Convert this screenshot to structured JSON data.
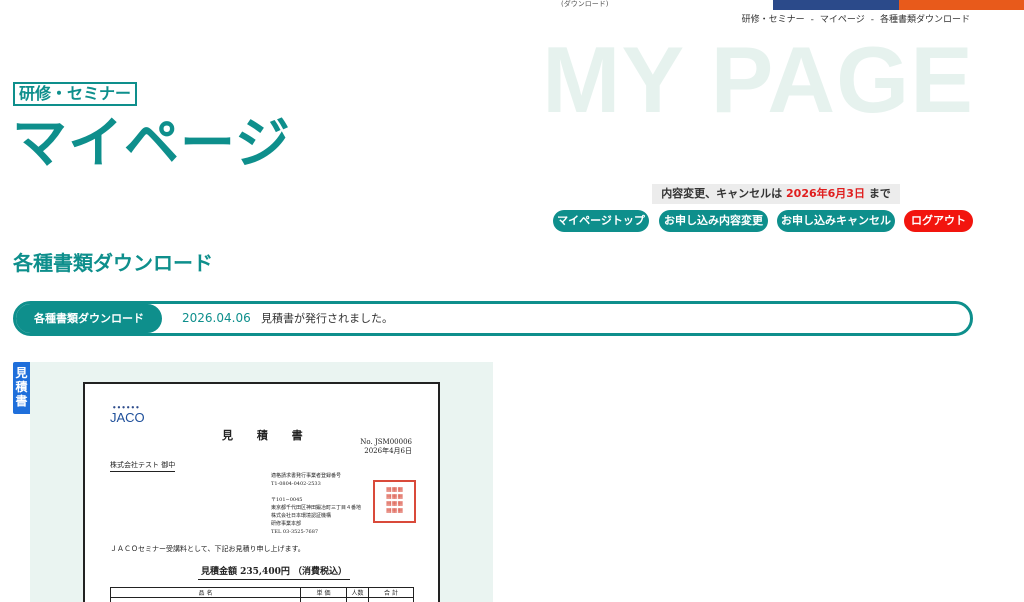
{
  "top": {
    "download_note": "(ダウンロード)",
    "colors": {
      "navy": "#2b4a8a",
      "orange": "#e85a1b"
    }
  },
  "breadcrumb": [
    "研修・セミナー",
    "マイページ",
    "各種書類ダウンロード"
  ],
  "breadcrumb_sep": "-",
  "hero": {
    "bg_title": "MY PAGE",
    "category": "研修・セミナー",
    "title": "マイページ"
  },
  "deadline": {
    "prefix": "内容変更、キャンセルは",
    "date": "2026年6月3日",
    "suffix": "まで"
  },
  "nav_buttons": {
    "mypage_top": "マイページトップ",
    "change": "お申し込み内容変更",
    "cancel": "お申し込みキャンセル",
    "logout": "ログアウト"
  },
  "section": {
    "heading": "各種書類ダウンロード"
  },
  "notice": {
    "tag": "各種書類ダウンロード",
    "date": "2026.04.06",
    "message": "見積書が発行されました。"
  },
  "document": {
    "tab_label": "見積書",
    "logo": "JACO",
    "title": "見 積 書",
    "number": "No. JSM00006",
    "date": "2026年4月6日",
    "addressee": "株式会社テスト 御中",
    "issuer_lines": [
      "適格請求書発行事業者登録番号",
      "T1-0804-0402-2533",
      "",
      "〒101−0045",
      "東京都千代田区神田鍛冶町三丁目４番地",
      "株式会社日本環境認証機構",
      "研修事業本部",
      "TEL 03-3525-7687"
    ],
    "intro": "ＪＡＣＯセミナー受講料として、下記お見積り申し上げます。",
    "total": "見積金額 235,400円 （消費税込）",
    "table_headers": [
      "品 名",
      "単 価",
      "人数",
      "合 計"
    ]
  },
  "colors": {
    "teal": "#0e8f8c",
    "red": "#f2150e",
    "blue_tab": "#1f6fdb",
    "doc_bg": "#eaf4f1"
  }
}
